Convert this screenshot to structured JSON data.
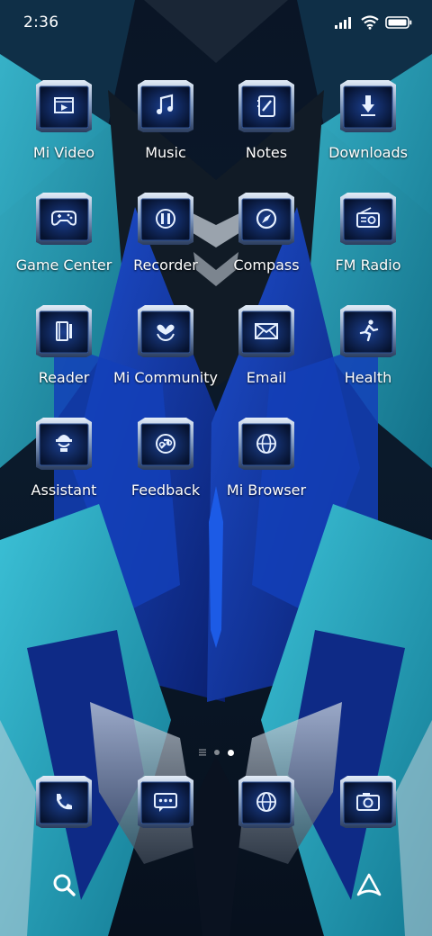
{
  "status": {
    "time": "2:36"
  },
  "apps": [
    {
      "label": "Mi Video",
      "icon": "video-icon"
    },
    {
      "label": "Music",
      "icon": "music-note-icon"
    },
    {
      "label": "Notes",
      "icon": "notebook-icon"
    },
    {
      "label": "Downloads",
      "icon": "download-arrow-icon"
    },
    {
      "label": "Game Center",
      "icon": "gamepad-icon"
    },
    {
      "label": "Recorder",
      "icon": "recorder-icon"
    },
    {
      "label": "Compass",
      "icon": "compass-icon"
    },
    {
      "label": "FM Radio",
      "icon": "radio-icon"
    },
    {
      "label": "Reader",
      "icon": "book-reader-icon"
    },
    {
      "label": "Mi Community",
      "icon": "community-heart-icon"
    },
    {
      "label": "Email",
      "icon": "envelope-icon"
    },
    {
      "label": "Health",
      "icon": "running-person-icon"
    },
    {
      "label": "Assistant",
      "icon": "assistant-icon"
    },
    {
      "label": "Feedback",
      "icon": "feedback-icon"
    },
    {
      "label": "Mi Browser",
      "icon": "globe-icon"
    }
  ],
  "dock": [
    {
      "icon": "phone-icon"
    },
    {
      "icon": "message-icon"
    },
    {
      "icon": "browser-globe-icon"
    },
    {
      "icon": "camera-icon"
    }
  ],
  "pager": {
    "pages": 2,
    "active_page": 2
  },
  "colors": {
    "accent": "#2aa3c2",
    "deep_blue": "#0b2f9a",
    "tile_frame": "#9fb6d6",
    "tile_inner": "#0a1a3c"
  }
}
